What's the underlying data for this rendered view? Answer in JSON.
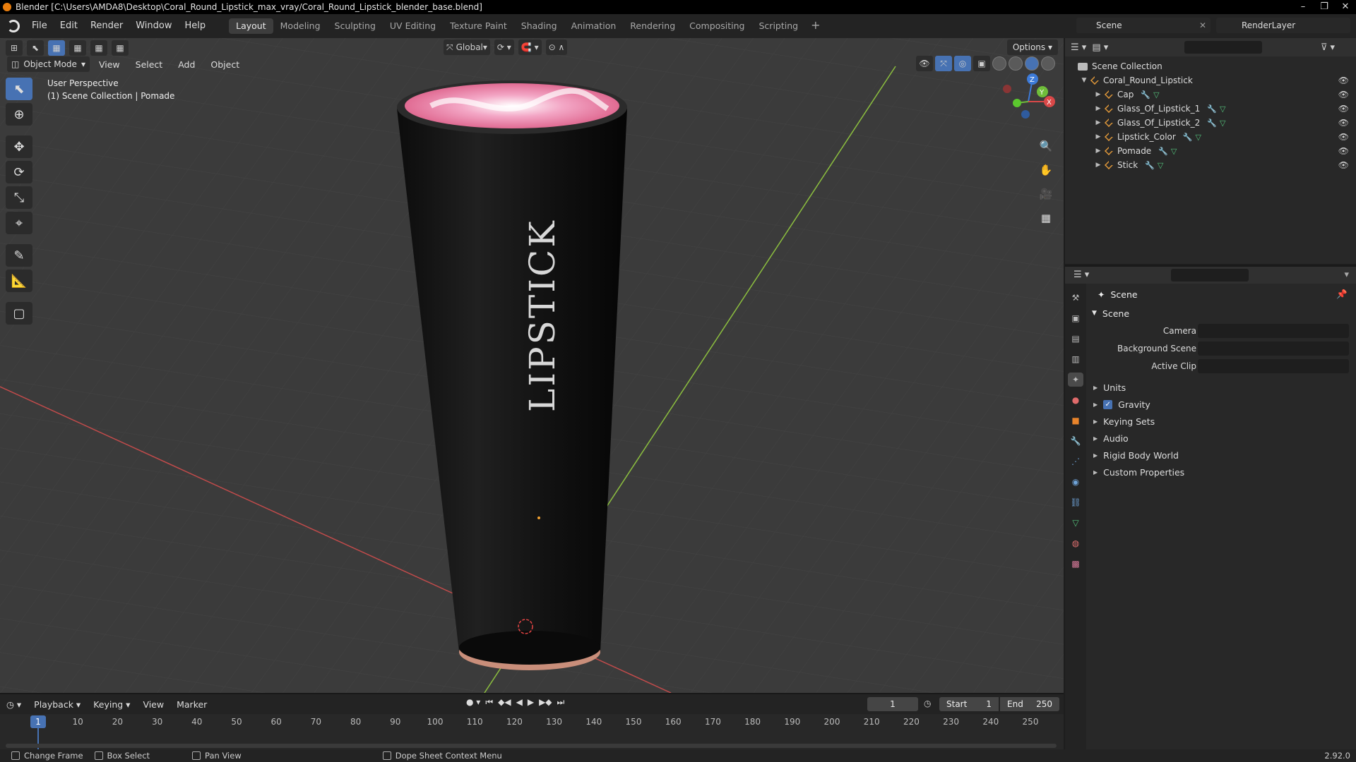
{
  "window": {
    "title": "Blender [C:\\Users\\AMDA8\\Desktop\\Coral_Round_Lipstick_max_vray/Coral_Round_Lipstick_blender_base.blend]"
  },
  "menubar": {
    "items": [
      "File",
      "Edit",
      "Render",
      "Window",
      "Help"
    ],
    "workspaces": [
      "Layout",
      "Modeling",
      "Sculpting",
      "UV Editing",
      "Texture Paint",
      "Shading",
      "Animation",
      "Rendering",
      "Compositing",
      "Scripting"
    ],
    "active_workspace": "Layout",
    "scene": "Scene",
    "view_layer": "RenderLayer"
  },
  "viewport": {
    "orientation": "Global",
    "options_label": "Options",
    "mode": "Object Mode",
    "menus": [
      "View",
      "Select",
      "Add",
      "Object"
    ],
    "perspective_label": "User Perspective",
    "collection_label": "(1) Scene Collection | Pomade",
    "object_text": "LIPSTICK",
    "gizmo_axes": [
      "Z",
      "Y",
      "X"
    ]
  },
  "timeline": {
    "menus": [
      "Playback",
      "Keying",
      "View",
      "Marker"
    ],
    "current_frame": "1",
    "start_label": "Start",
    "start_value": "1",
    "end_label": "End",
    "end_value": "250",
    "ticks": [
      "10",
      "20",
      "30",
      "40",
      "50",
      "60",
      "70",
      "80",
      "90",
      "100",
      "110",
      "120",
      "130",
      "140",
      "150",
      "160",
      "170",
      "180",
      "190",
      "200",
      "210",
      "220",
      "230",
      "240",
      "250"
    ],
    "cursor_label": "1"
  },
  "statusbar": {
    "items": [
      "Change Frame",
      "Box Select",
      "Pan View",
      "Dope Sheet Context Menu"
    ],
    "version": "2.92.0"
  },
  "outliner": {
    "root": "Scene Collection",
    "collection": "Coral_Round_Lipstick",
    "objects": [
      "Cap",
      "Glass_Of_Lipstick_1",
      "Glass_Of_Lipstick_2",
      "Lipstick_Color",
      "Pomade",
      "Stick"
    ]
  },
  "properties": {
    "context_title": "Scene",
    "panel_title": "Scene",
    "fields": {
      "camera": "Camera",
      "background_scene": "Background Scene",
      "active_clip": "Active Clip"
    },
    "subpanels": [
      "Units",
      "Gravity",
      "Keying Sets",
      "Audio",
      "Rigid Body World",
      "Custom Properties"
    ],
    "gravity_checked": true,
    "tab_colors": [
      "#bbbbbb",
      "#bbbbbb",
      "#bbbbbb",
      "#bbbbbb",
      "#bbbbbb",
      "#e06b6b",
      "#e8842b",
      "#6fa3d8",
      "#6fa3d8",
      "#6fa3d8",
      "#6fa3d8",
      "#53c17b",
      "#e07070",
      "#d97a9a"
    ]
  },
  "colors": {
    "accent": "#4772b3",
    "x_axis": "#c14b4b",
    "y_axis": "#8cbf3f"
  }
}
